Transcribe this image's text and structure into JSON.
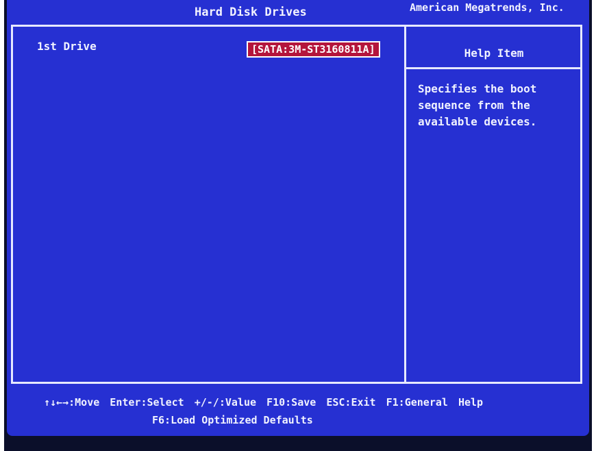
{
  "header": {
    "title": "Hard Disk Drives",
    "vendor": "American Megatrends, Inc."
  },
  "main": {
    "option_label": "1st Drive",
    "option_value": "[SATA:3M-ST3160811A]"
  },
  "help": {
    "title": "Help Item",
    "text": "Specifies the boot sequence from the available devices."
  },
  "footer": {
    "keys_line1": "↑↓←→:Move  Enter:Select  +/-/:Value  F10:Save  ESC:Exit  F1:General Help",
    "keys_line2": "F6:Load Optimized Defaults"
  },
  "colors": {
    "screen_background": "#2630d2",
    "selected_highlight": "#b4153c",
    "border": "#e6e9ff"
  }
}
